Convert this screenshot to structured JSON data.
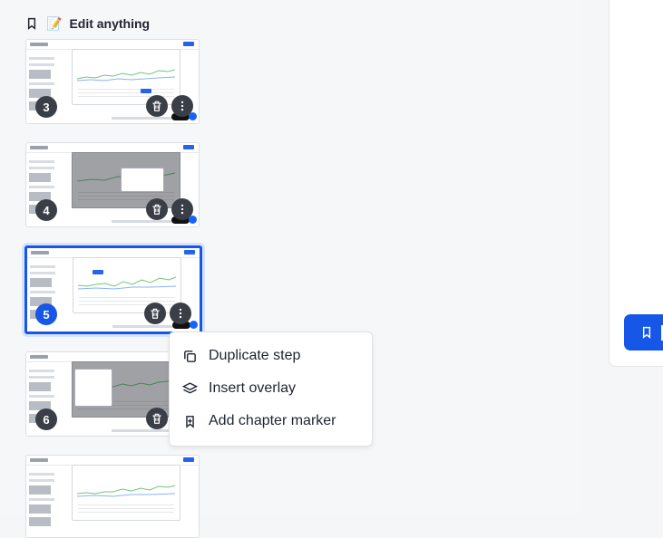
{
  "chapter": {
    "bookmark_icon": "bookmark-icon",
    "emoji": "📝",
    "title": "Edit anything"
  },
  "steps": [
    {
      "number": "3",
      "state": "normal"
    },
    {
      "number": "4",
      "state": "modal"
    },
    {
      "number": "5",
      "state": "selected"
    },
    {
      "number": "6",
      "state": "overlay"
    }
  ],
  "menu": {
    "items": [
      {
        "label": "Duplicate step",
        "icon": "duplicate-icon"
      },
      {
        "label": "Insert overlay",
        "icon": "layers-icon"
      },
      {
        "label": "Add chapter marker",
        "icon": "bookmark-plus-icon"
      }
    ]
  },
  "colors": {
    "accent": "#1657E8",
    "step_badge": "#3A3E47",
    "menu_bg": "#FFFFFF"
  }
}
